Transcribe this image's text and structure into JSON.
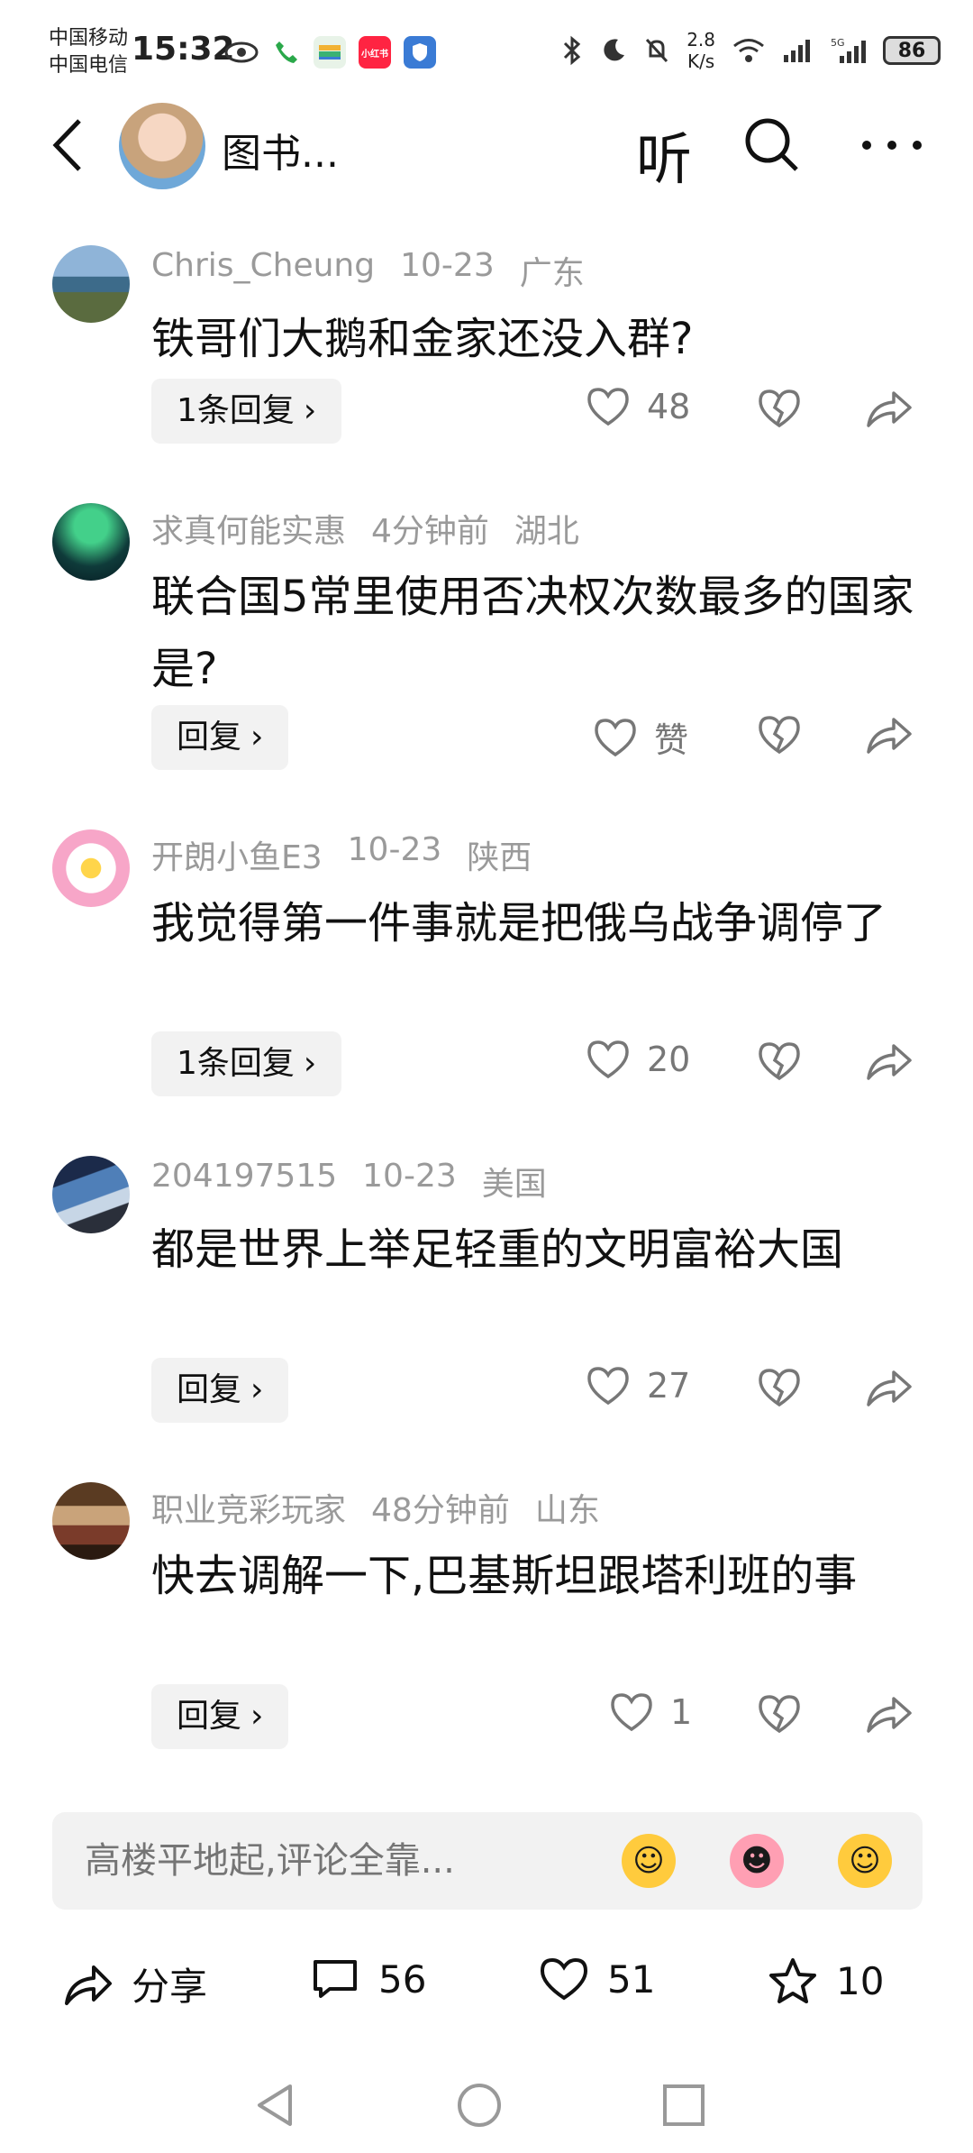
{
  "status_bar": {
    "carrier1": "中国移动",
    "carrier2": "中国电信",
    "time": "15:32",
    "speed_value": "2.8",
    "speed_unit": "K/s",
    "battery": "86",
    "app_badge": "小红书"
  },
  "header": {
    "title": "图书...",
    "listen_label": "听"
  },
  "comments": [
    {
      "user": "Chris_Cheung",
      "time": "10-23",
      "location": "广东",
      "text": "铁哥们大鹅和金家还没入群?",
      "reply_label": "1条回复",
      "likes": "48"
    },
    {
      "user": "求真何能实惠",
      "time": "4分钟前",
      "location": "湖北",
      "text": "联合国5常里使用否决权次数最多的国家是?",
      "reply_label": "回复",
      "likes": "赞"
    },
    {
      "user": "开朗小鱼E3",
      "time": "10-23",
      "location": "陕西",
      "text": "我觉得第一件事就是把俄乌战争调停了",
      "reply_label": "1条回复",
      "likes": "20"
    },
    {
      "user": "204197515",
      "time": "10-23",
      "location": "美国",
      "text": "都是世界上举足轻重的文明富裕大国",
      "reply_label": "回复",
      "likes": "27"
    },
    {
      "user": "职业竞彩玩家",
      "time": "48分钟前",
      "location": "山东",
      "text": "快去调解一下,巴基斯坦跟塔利班的事",
      "reply_label": "回复",
      "likes": "1"
    }
  ],
  "input": {
    "placeholder": "高楼平地起,评论全靠..."
  },
  "bottom_actions": {
    "share_label": "分享",
    "comments_count": "56",
    "likes_count": "51",
    "favorites_count": "10"
  },
  "colors": {
    "meta_gray": "#9a9a9a",
    "reply_bg": "#f2f2f2",
    "input_bg": "#f2f2f2"
  }
}
